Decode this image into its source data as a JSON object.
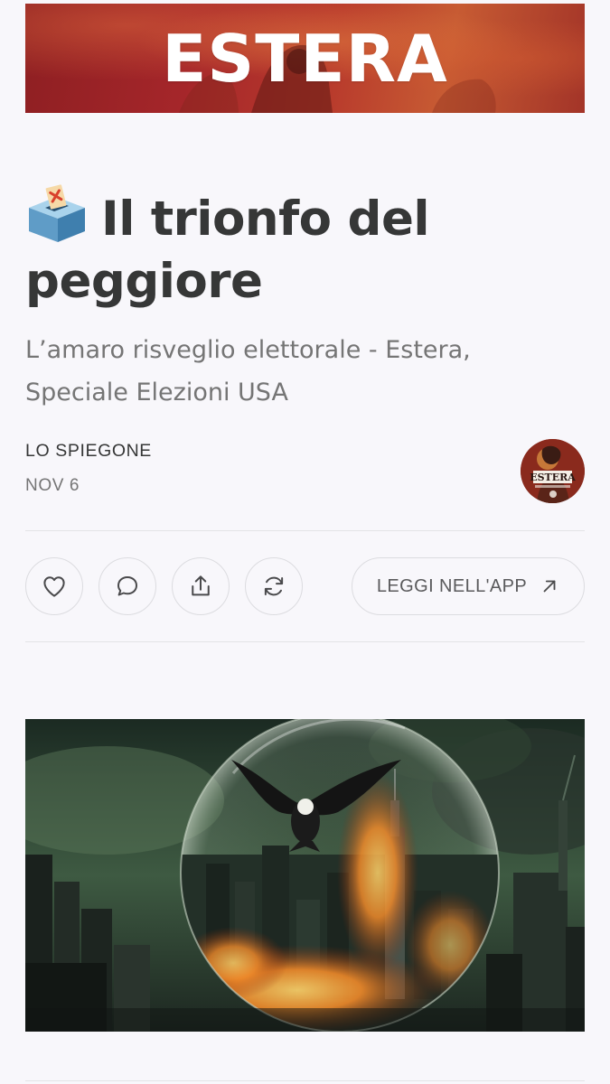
{
  "banner": {
    "title": "ESTERA",
    "colors": {
      "start": "#8e1f22",
      "mid": "#b83a2c",
      "end": "#c75b33"
    }
  },
  "post": {
    "title_icon": "ballot-box-icon",
    "title": "Il trionfo del peggiore",
    "subtitle": "L’amaro risveglio elettorale - Estera, Speciale Elezioni USA",
    "author": "LO SPIEGONE",
    "date": "NOV 6"
  },
  "avatar": {
    "name": "publication-avatar",
    "text": "ESTERA"
  },
  "actions": {
    "like_icon": "heart-icon",
    "comment_icon": "comment-icon",
    "share_icon": "share-icon",
    "restack_icon": "restack-icon",
    "read_in_app_label": "LEGGI NELL'APP",
    "read_in_app_icon": "arrow-up-right-icon"
  },
  "hero": {
    "description_icon": "hero-illustration"
  },
  "colors": {
    "background": "#f8f7fb",
    "text_primary": "#363737",
    "text_secondary": "#757575",
    "border": "#dcdce0"
  }
}
